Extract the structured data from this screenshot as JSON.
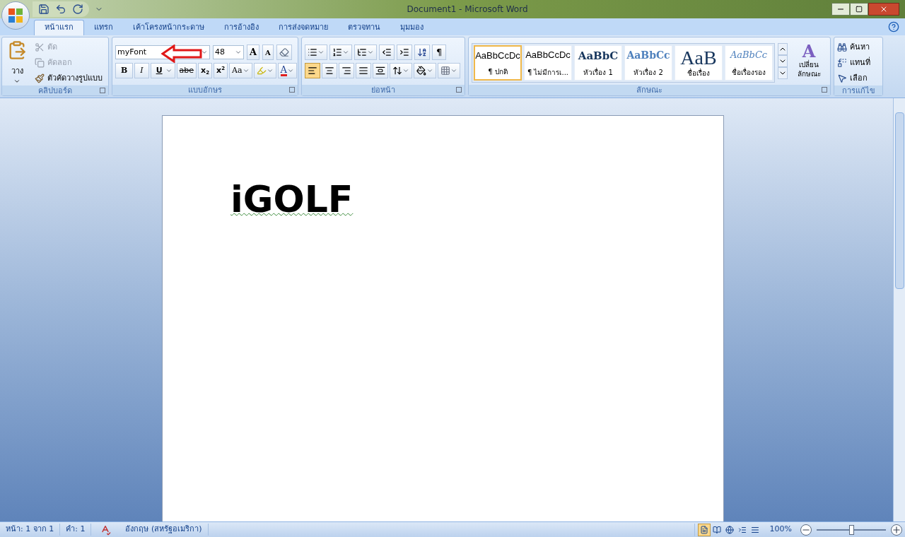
{
  "window": {
    "title": "Document1 - Microsoft Word"
  },
  "tabs": [
    {
      "label": "หน้าแรก",
      "selected": true
    },
    {
      "label": "แทรก",
      "selected": false
    },
    {
      "label": "เค้าโครงหน้ากระดาษ",
      "selected": false
    },
    {
      "label": "การอ้างอิง",
      "selected": false
    },
    {
      "label": "การส่งจดหมาย",
      "selected": false
    },
    {
      "label": "ตรวจทาน",
      "selected": false
    },
    {
      "label": "มุมมอง",
      "selected": false
    }
  ],
  "clipboard": {
    "label": "คลิปบอร์ด",
    "paste": "วาง",
    "items": [
      {
        "kind": "cut",
        "label": "ตัด",
        "disabled": true
      },
      {
        "kind": "copy",
        "label": "คัดลอก",
        "disabled": true
      },
      {
        "kind": "painter",
        "label": "ตัวคัดวางรูปแบบ",
        "disabled": false
      }
    ]
  },
  "font": {
    "label": "แบบอักษร",
    "name": "myFont",
    "size": "48",
    "grow": "A",
    "shrink": "A",
    "format": [
      "B",
      "I",
      "U",
      "abe",
      "x",
      "x",
      "Aa"
    ],
    "sub_mark": "2",
    "sup_mark": "2",
    "color_letter": "A"
  },
  "paragraph": {
    "label": "ย่อหน้า",
    "pilcrow": "¶",
    "align": [
      {
        "kind": "left",
        "selected": true
      },
      {
        "kind": "center",
        "selected": false
      },
      {
        "kind": "right",
        "selected": false
      },
      {
        "kind": "justify",
        "selected": false
      },
      {
        "kind": "distributed",
        "selected": false
      }
    ]
  },
  "styles": {
    "label": "ลักษณะ",
    "change": "เปลี่ยน ลักษณะ",
    "change_letter": "A",
    "items": [
      {
        "kind": "normal",
        "preview": "AaBbCcDc",
        "name": "¶ ปกติ",
        "selected": true
      },
      {
        "kind": "normal",
        "preview": "AaBbCcDc",
        "name": "¶ ไม่มีการเ...",
        "selected": false
      },
      {
        "kind": "heading1",
        "preview": "AaBbC",
        "name": "หัวเรื่อง 1",
        "selected": false
      },
      {
        "kind": "heading2",
        "preview": "AaBbCc",
        "name": "หัวเรื่อง 2",
        "selected": false
      },
      {
        "kind": "title",
        "preview": "AaB",
        "name": "ชื่อเรื่อง",
        "selected": false
      },
      {
        "kind": "subtitle",
        "preview": "AaBbCc",
        "name": "ชื่อเรื่องรอง",
        "selected": false
      }
    ]
  },
  "editing": {
    "label": "การแก้ไข",
    "items": [
      {
        "kind": "find",
        "label": "ค้นหา"
      },
      {
        "kind": "replace",
        "label": "แทนที่"
      },
      {
        "kind": "select",
        "label": "เลือก"
      }
    ]
  },
  "document": {
    "text": "iGOLF"
  },
  "status_bar": {
    "page": "หน้า: 1 จาก 1",
    "words": "คำ: 1",
    "language": "อังกฤษ (สหรัฐอเมริกา)",
    "views": [
      {
        "selected": true
      },
      {
        "selected": false
      },
      {
        "selected": false
      },
      {
        "selected": false
      },
      {
        "selected": false
      }
    ],
    "zoom": "100%",
    "zoom_slider": {
      "level": 0.5
    }
  }
}
